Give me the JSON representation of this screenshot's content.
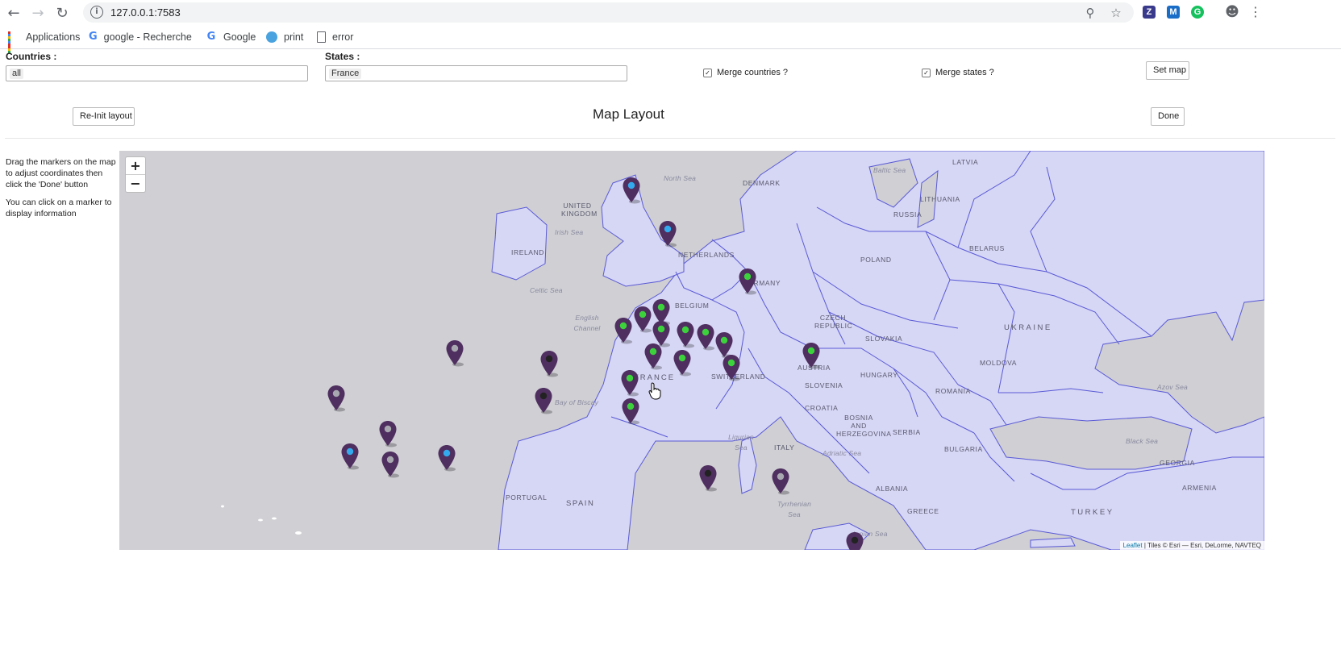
{
  "browser": {
    "url": "127.0.0.1:7583",
    "bookmarks": [
      {
        "label": "Applications",
        "icon": "apps-grid-icon"
      },
      {
        "label": "google - Recherche G",
        "icon": "google-icon"
      },
      {
        "label": "Google",
        "icon": "google-icon"
      },
      {
        "label": "print",
        "icon": "print-site-icon"
      },
      {
        "label": "error",
        "icon": "document-icon"
      }
    ],
    "extensions": [
      "Z",
      "M",
      "G"
    ]
  },
  "controls": {
    "countries_label": "Countries :",
    "countries_value": "all",
    "states_label": "States :",
    "states_value": "France",
    "merge_countries_label": "Merge countries ?",
    "merge_countries_checked": true,
    "merge_states_label": "Merge states ?",
    "merge_states_checked": true,
    "set_map_label": "Set map"
  },
  "layout": {
    "reinit_label": "Re-Init layout",
    "title": "Map Layout",
    "done_label": "Done"
  },
  "instructions": {
    "line1": "Drag the markers on the map to adjust coordinates then click the 'Done' button",
    "line2": "You can click on a marker to display information"
  },
  "map": {
    "zoom_in": "+",
    "zoom_out": "−",
    "attribution_link": "Leaflet",
    "attribution_text": " | Tiles © Esri — Esri, DeLorme, NAVTEQ",
    "land_color": "#d6d6f5",
    "sea_color": "#cfcfd4",
    "border_color": "#5a5ad6",
    "marker_color": "#4f2f5f",
    "dot_colors": {
      "green": "#3cd23c",
      "blue": "#33aaee",
      "gray": "#a8a8b0",
      "dark": "#222222"
    },
    "labels": {
      "north_sea": "North Sea",
      "baltic_sea": "Baltic Sea",
      "latvia": "LATVIA",
      "denmark": "DENMARK",
      "lithuania": "LITHUANIA",
      "russia": "RUSSIA",
      "united_kingdom": "UNITED KINGDOM",
      "irish_sea": "Irish Sea",
      "ireland": "IRELAND",
      "netherlands": "NETHERLANDS",
      "poland": "POLAND",
      "belarus": "BELARUS",
      "germany": "GERMANY",
      "celtic_sea": "Celtic Sea",
      "belgium": "BELGIUM",
      "english_channel": "English Channel",
      "czech_republic": "CZECH REPUBLIC",
      "ukraine": "UKRAINE",
      "slovakia": "SLOVAKIA",
      "france": "FRANCE",
      "austria": "AUSTRIA",
      "switzerland": "SWITZERLAND",
      "moldova": "MOLDOVA",
      "hungary": "HUNGARY",
      "slovenia": "SLOVENIA",
      "romania": "ROMANIA",
      "bay_of_biscay": "Bay of Biscay",
      "croatia": "CROATIA",
      "azov_sea": "Azov Sea",
      "bosnia": "BOSNIA AND HERZEGOVINA",
      "serbia": "SERBIA",
      "black_sea": "Black Sea",
      "bulgaria": "BULGARIA",
      "ligurian_sea": "Ligurian Sea",
      "italy": "ITALY",
      "adriatic_sea": "Adriatic Sea",
      "georgia": "GEORGIA",
      "portugal": "PORTUGAL",
      "spain": "SPAIN",
      "albania": "ALBANIA",
      "armenia": "ARMENIA",
      "tyrrhenian_sea": "Tyrrhenian Sea",
      "turkey": "TURKEY",
      "greece": "GREECE",
      "ionian_sea": "Ionian Sea"
    },
    "markers": [
      {
        "dot": "blue"
      },
      {
        "dot": "blue"
      },
      {
        "dot": "green"
      },
      {
        "dot": "green"
      },
      {
        "dot": "green"
      },
      {
        "dot": "green"
      },
      {
        "dot": "green"
      },
      {
        "dot": "green"
      },
      {
        "dot": "green"
      },
      {
        "dot": "green"
      },
      {
        "dot": "green"
      },
      {
        "dot": "green"
      },
      {
        "dot": "green"
      },
      {
        "dot": "green"
      },
      {
        "dot": "green"
      },
      {
        "dot": "green"
      },
      {
        "dot": "green"
      },
      {
        "dot": "gray"
      },
      {
        "dot": "dark"
      },
      {
        "dot": "dark"
      },
      {
        "dot": "gray"
      },
      {
        "dot": "gray"
      },
      {
        "dot": "blue"
      },
      {
        "dot": "gray"
      },
      {
        "dot": "blue"
      },
      {
        "dot": "dark"
      },
      {
        "dot": "gray"
      },
      {
        "dot": "dark"
      }
    ]
  }
}
